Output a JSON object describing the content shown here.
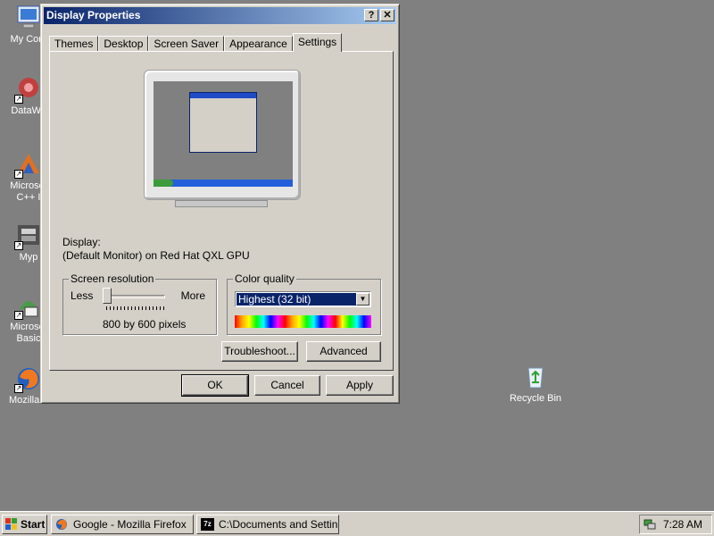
{
  "desktop": {
    "icons": [
      {
        "label": "My Com"
      },
      {
        "label": "DataWa"
      },
      {
        "label": "Microsof",
        "label2": "C++ I"
      },
      {
        "label": "Myp"
      },
      {
        "label": "Microsof",
        "label2": "Basic"
      },
      {
        "label": "Mozilla F"
      },
      {
        "label": "Recycle Bin"
      }
    ]
  },
  "window": {
    "title": "Display Properties",
    "help_label": "?",
    "close_label": "✕",
    "tabs": [
      {
        "label": "Themes"
      },
      {
        "label": "Desktop"
      },
      {
        "label": "Screen Saver"
      },
      {
        "label": "Appearance"
      },
      {
        "label": "Settings"
      }
    ],
    "display_label": "Display:",
    "display_value": "(Default Monitor) on Red Hat QXL GPU",
    "resolution": {
      "legend": "Screen resolution",
      "less": "Less",
      "more": "More",
      "value": "800 by 600 pixels",
      "slider_position": 0
    },
    "color_quality": {
      "legend": "Color quality",
      "selected": "Highest (32 bit)"
    },
    "troubleshoot_label": "Troubleshoot...",
    "advanced_label": "Advanced",
    "ok_label": "OK",
    "cancel_label": "Cancel",
    "apply_label": "Apply"
  },
  "taskbar": {
    "start_label": "Start",
    "tasks": [
      {
        "label": "Google - Mozilla Firefox"
      },
      {
        "label": "C:\\Documents and Settin..."
      }
    ],
    "clock": "7:28 AM"
  },
  "colors": {
    "desktop": "#808080",
    "titlebar_start": "#0a246a",
    "titlebar_end": "#a6caf0",
    "face": "#d4d0c8"
  }
}
